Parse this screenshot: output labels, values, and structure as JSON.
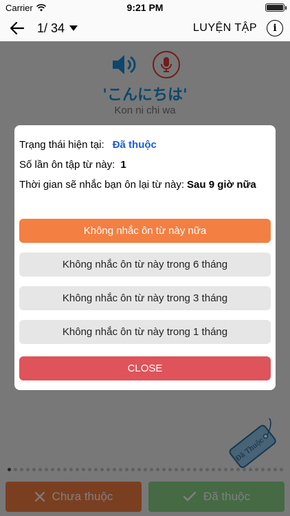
{
  "status_bar": {
    "carrier": "Carrier",
    "time": "9:21 PM"
  },
  "nav": {
    "counter": "1/ 34",
    "title": "LUYỆN TẬP",
    "info_glyph": "i"
  },
  "word": {
    "japanese": "'こんにちは'",
    "romaji": "Kon ni chi wa"
  },
  "dialog": {
    "status_label": "Trạng thái hiện tại:",
    "status_value": "Đã thuộc",
    "review_count_label": "Số lần ôn tập từ này:",
    "review_count_value": "1",
    "reminder_label": "Thời gian sẽ nhắc bạn ôn lại từ này:",
    "reminder_value": "Sau 9 giờ nữa",
    "buttons": [
      "Không nhắc ôn từ này nữa",
      "Không nhắc ôn từ này trong 6 tháng",
      "Không nhắc ôn từ này trong 3 tháng",
      "Không nhắc ôn từ này trong 1 tháng"
    ],
    "close_label": "CLOSE"
  },
  "tag": {
    "label": "Đã Thuộc"
  },
  "bottom": {
    "unlearned_label": "Chưa thuộc",
    "learned_label": "Đã thuộc"
  },
  "colors": {
    "accent_orange": "#f47f42",
    "close_red": "#df535a",
    "learned_green": "#8bd488",
    "link_blue": "#1b5ed6"
  }
}
